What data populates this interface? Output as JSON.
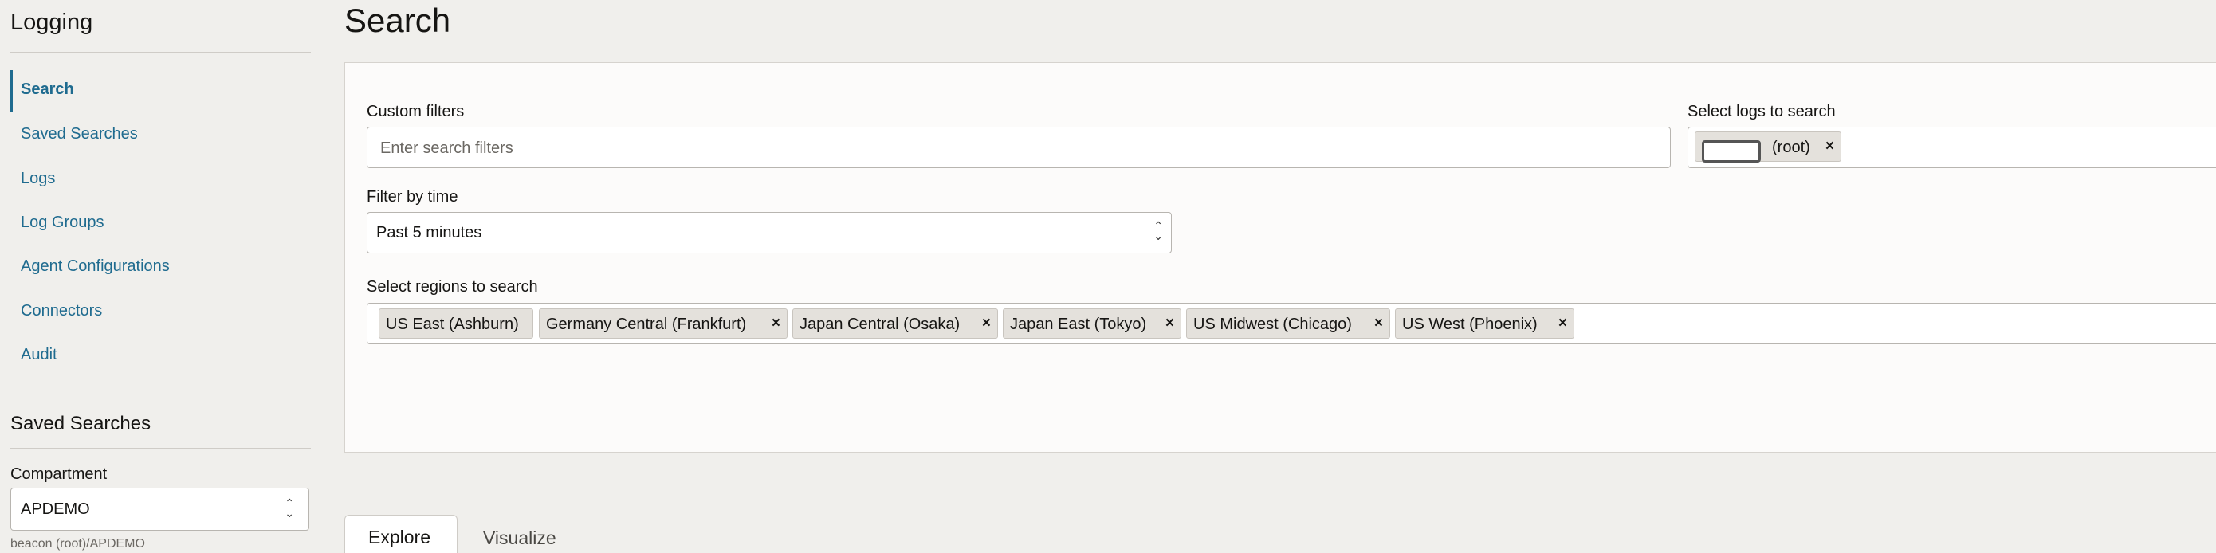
{
  "sidebar": {
    "title": "Logging",
    "nav": [
      {
        "label": "Search",
        "active": true
      },
      {
        "label": "Saved Searches"
      },
      {
        "label": "Logs"
      },
      {
        "label": "Log Groups"
      },
      {
        "label": "Agent Configurations"
      },
      {
        "label": "Connectors"
      },
      {
        "label": "Audit"
      }
    ],
    "saved_title": "Saved Searches",
    "compartment_label": "Compartment",
    "compartment_value": "APDEMO",
    "compartment_path": "beacon (root)/APDEMO"
  },
  "main": {
    "title": "Search",
    "custom_filters_label": "Custom filters",
    "custom_filters_placeholder": "Enter search filters",
    "select_logs_label": "Select logs to search",
    "selected_log": "(root)",
    "filter_time_label": "Filter by time",
    "filter_time_value": "Past 5 minutes",
    "regions_label": "Select regions to search",
    "regions": [
      {
        "label": "US East (Ashburn)",
        "removable": false
      },
      {
        "label": "Germany Central (Frankfurt)",
        "removable": true
      },
      {
        "label": "Japan Central (Osaka)",
        "removable": true
      },
      {
        "label": "Japan East (Tokyo)",
        "removable": true
      },
      {
        "label": "US Midwest (Chicago)",
        "removable": true
      },
      {
        "label": "US West (Phoenix)",
        "removable": true
      }
    ],
    "remove_glyph": "×",
    "tabs": [
      {
        "label": "Explore",
        "active": true
      },
      {
        "label": "Visualize"
      }
    ]
  },
  "colors": {
    "link": "#1f6b8f",
    "background": "#f0efec",
    "panel": "#fcfbfa"
  }
}
